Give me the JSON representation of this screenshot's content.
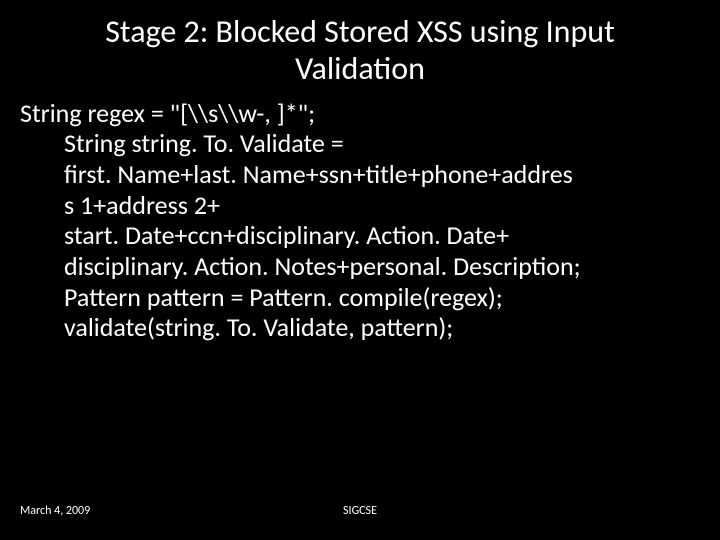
{
  "title_line1": "Stage 2: Blocked Stored XSS using Input",
  "title_line2": "Validation",
  "body": {
    "l1": "String regex = \"[\\\\s\\\\w-, ]*\";",
    "l2": "String string. To. Validate =",
    "l3": "first. Name+last. Name+ssn+title+phone+addres",
    "l4": "s 1+address 2+",
    "l5": "start. Date+ccn+disciplinary. Action. Date+",
    "l6": "disciplinary. Action. Notes+personal. Description;",
    "l7": "Pattern pattern = Pattern. compile(regex);",
    "l8": "validate(string. To. Validate, pattern);"
  },
  "footer": {
    "date": "March 4, 2009",
    "conf": "SIGCSE"
  }
}
